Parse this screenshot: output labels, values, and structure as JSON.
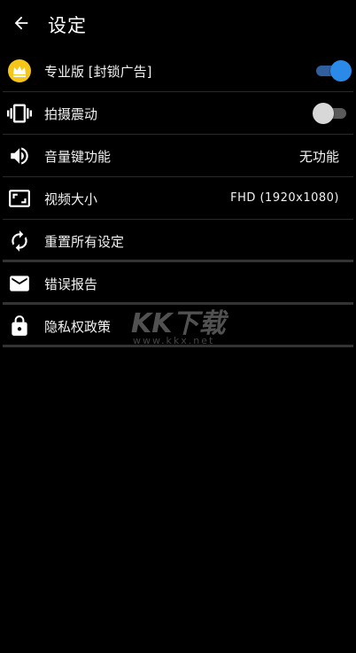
{
  "toolbar": {
    "title": "设定",
    "back_icon": "arrow-left-icon"
  },
  "settings": {
    "items": [
      {
        "label": "专业版 [封锁广告]",
        "icon": "crown-icon",
        "control": "switch",
        "checked": true
      },
      {
        "label": "拍摄震动",
        "icon": "vibration-icon",
        "control": "switch",
        "checked": false
      },
      {
        "label": "音量键功能",
        "icon": "volume-icon",
        "value": "无功能"
      },
      {
        "label": "视频大小",
        "icon": "aspect-ratio-icon",
        "value": "FHD (1920x1080)"
      },
      {
        "label": "重置所有设定",
        "icon": "reset-icon"
      },
      {
        "label": "错误报告",
        "icon": "mail-icon"
      },
      {
        "label": "隐私权政策",
        "icon": "lock-icon"
      }
    ]
  },
  "watermark": {
    "big": "KK下载",
    "small": "www.kkx.net"
  },
  "colors": {
    "background": "#000000",
    "accent": "#2b8ae8",
    "crown": "#f5c518"
  }
}
